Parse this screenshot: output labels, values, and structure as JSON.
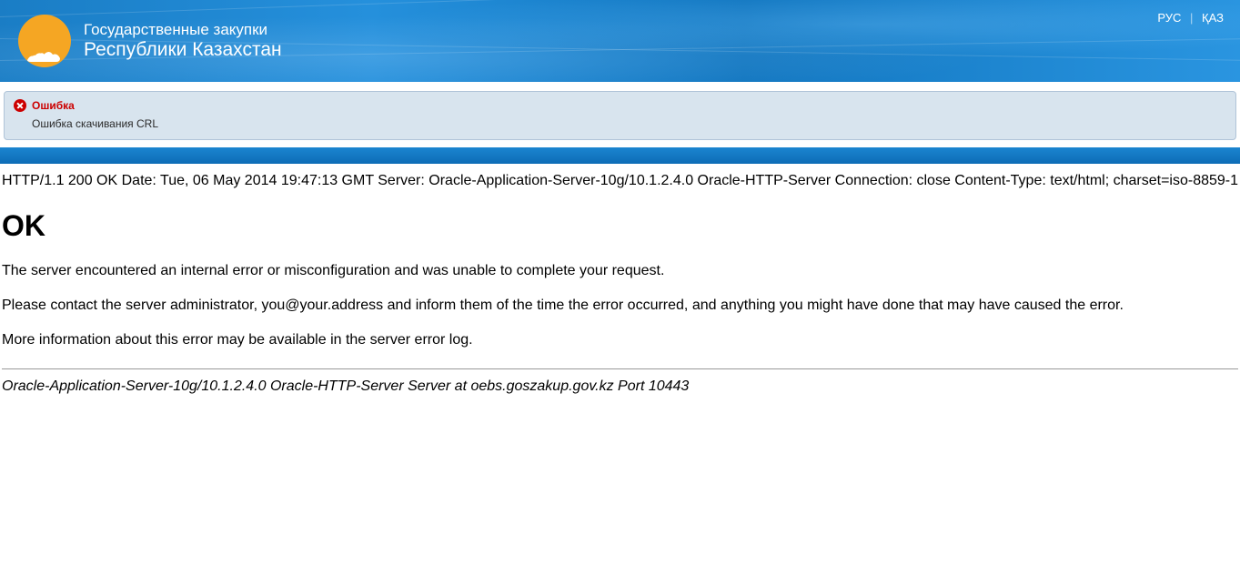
{
  "header": {
    "title_line1": "Государственные закупки",
    "title_line2": "Республики Казахстан"
  },
  "lang": {
    "rus": "РУС",
    "kaz": "ҚАЗ"
  },
  "error": {
    "title": "Ошибка",
    "message": "Ошибка скачивания CRL"
  },
  "http": {
    "response_line": "HTTP/1.1 200 OK Date: Tue, 06 May 2014 19:47:13 GMT Server: Oracle-Application-Server-10g/10.1.2.4.0 Oracle-HTTP-Server Connection: close Content-Type: text/html; charset=iso-8859-1",
    "heading": "OK",
    "para1": "The server encountered an internal error or misconfiguration and was unable to complete your request.",
    "para2": "Please contact the server administrator, you@your.address and inform them of the time the error occurred, and anything you might have done that may have caused the error.",
    "para3": "More information about this error may be available in the server error log.",
    "footer": "Oracle-Application-Server-10g/10.1.2.4.0 Oracle-HTTP-Server Server at oebs.goszakup.gov.kz Port 10443"
  }
}
